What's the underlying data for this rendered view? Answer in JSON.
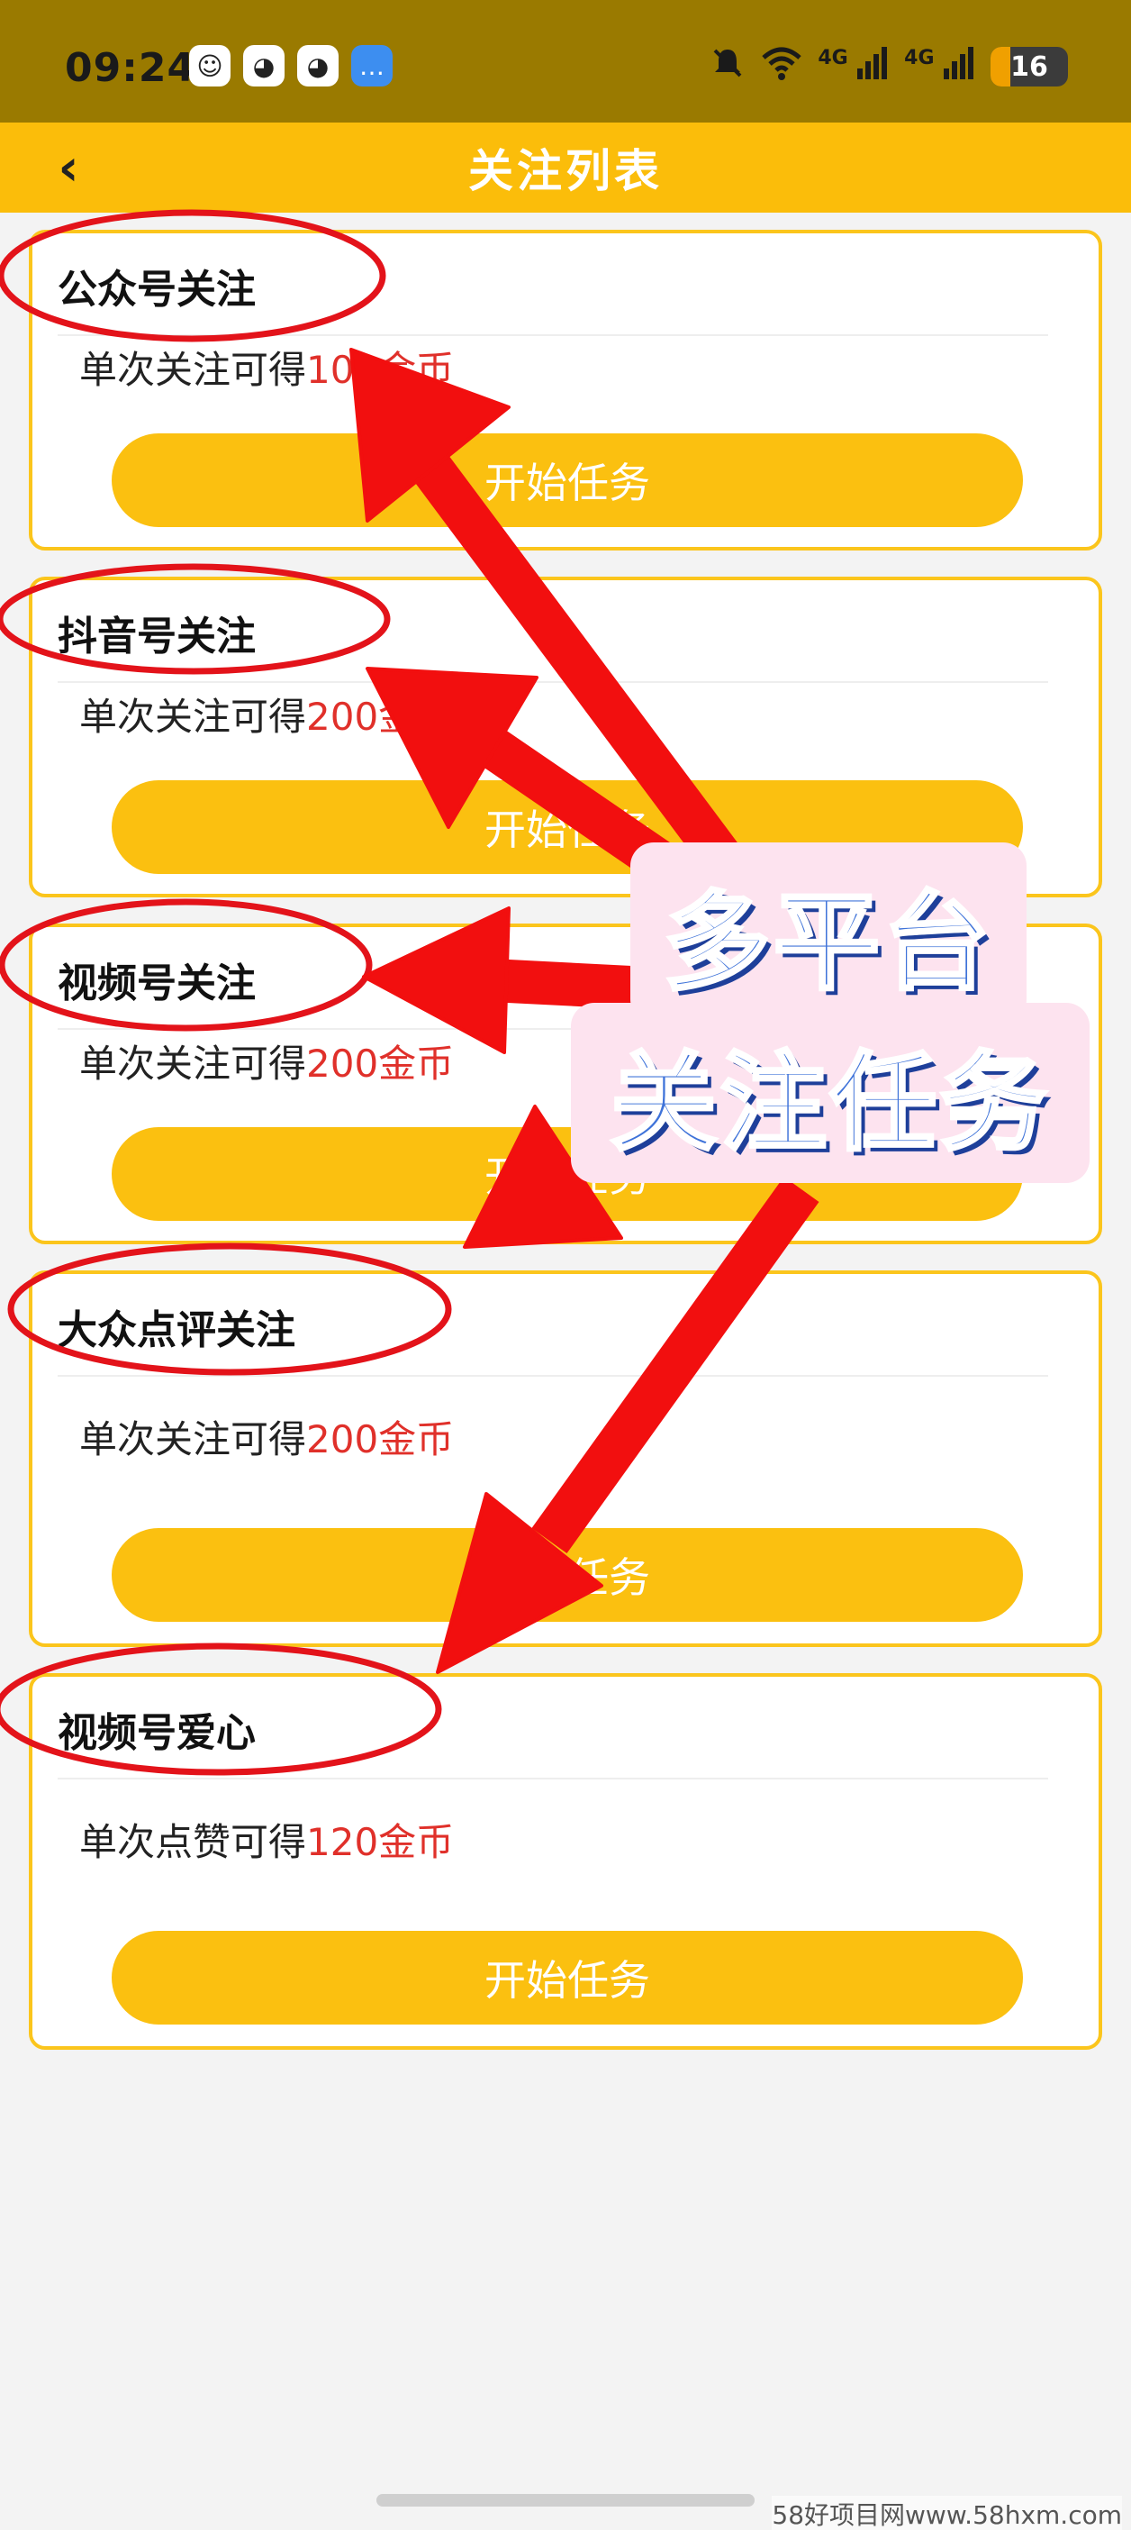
{
  "status_bar": {
    "time": "09:24",
    "notifications": [
      {
        "icon": "avatar-icon",
        "glyph": "☺"
      },
      {
        "icon": "qq-icon",
        "glyph": "◕"
      },
      {
        "icon": "qq-icon",
        "glyph": "◕"
      },
      {
        "icon": "message-icon",
        "glyph": "…"
      }
    ],
    "network_1": "4G",
    "network_2": "4G",
    "battery": "16"
  },
  "header": {
    "back_glyph": "‹",
    "title": "关注列表"
  },
  "cards": [
    {
      "title": "公众号关注",
      "desc_prefix": "单次关注可得",
      "coins": "100金币",
      "button": "开始任务"
    },
    {
      "title": "抖音号关注",
      "desc_prefix": "单次关注可得",
      "coins": "200金币",
      "button": "开始任务"
    },
    {
      "title": "视频号关注",
      "desc_prefix": "单次关注可得",
      "coins": "200金币",
      "button": "开始任务"
    },
    {
      "title": "大众点评关注",
      "desc_prefix": "单次关注可得",
      "coins": "200金币",
      "button": "开始任务"
    },
    {
      "title": "视频号爱心",
      "desc_prefix": "单次点赞可得",
      "coins": "120金币",
      "button": "开始任务"
    }
  ],
  "annotation": {
    "line1": "多平台",
    "line2": "关注任务",
    "circle_color": "#e3131a",
    "arrow_color": "#f20f0f"
  },
  "watermark": "58好项目网www.58hxm.com",
  "colors": {
    "accent": "#fbbd0a",
    "status_bar": "#9a7a00",
    "coin_text": "#e0302a"
  }
}
